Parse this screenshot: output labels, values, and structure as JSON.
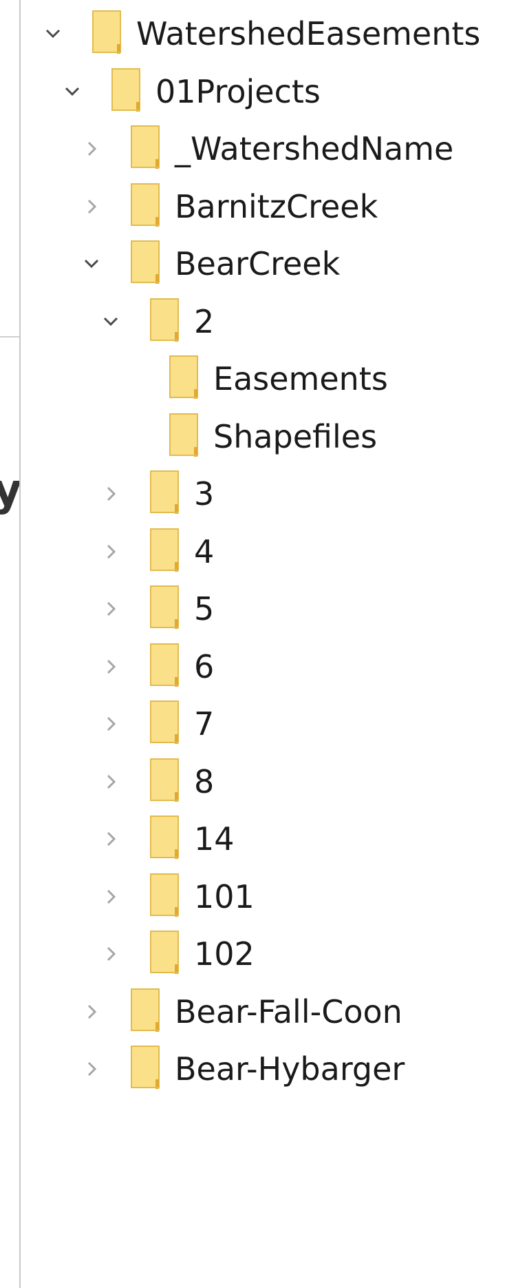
{
  "background": {
    "fragment_text": "ys"
  },
  "tree": {
    "folder_color": "#fbe08a",
    "items": [
      {
        "label": "WatershedEasements",
        "expander": "expanded",
        "depth": 0
      },
      {
        "label": "01Projects",
        "expander": "expanded",
        "depth": 1
      },
      {
        "label": "_WatershedName",
        "expander": "collapsed",
        "depth": 2
      },
      {
        "label": "BarnitzCreek",
        "expander": "collapsed",
        "depth": 2
      },
      {
        "label": "BearCreek",
        "expander": "expanded",
        "depth": 2
      },
      {
        "label": "2",
        "expander": "expanded",
        "depth": 3
      },
      {
        "label": "Easements",
        "expander": "none",
        "depth": 4
      },
      {
        "label": "Shapefiles",
        "expander": "none",
        "depth": 4
      },
      {
        "label": "3",
        "expander": "collapsed",
        "depth": 3
      },
      {
        "label": "4",
        "expander": "collapsed",
        "depth": 3
      },
      {
        "label": "5",
        "expander": "collapsed",
        "depth": 3
      },
      {
        "label": "6",
        "expander": "collapsed",
        "depth": 3
      },
      {
        "label": "7",
        "expander": "collapsed",
        "depth": 3
      },
      {
        "label": "8",
        "expander": "collapsed",
        "depth": 3
      },
      {
        "label": "14",
        "expander": "collapsed",
        "depth": 3
      },
      {
        "label": "101",
        "expander": "collapsed",
        "depth": 3
      },
      {
        "label": "102",
        "expander": "collapsed",
        "depth": 3
      },
      {
        "label": "Bear-Fall-Coon",
        "expander": "collapsed",
        "depth": 2
      },
      {
        "label": "Bear-Hybarger",
        "expander": "collapsed",
        "depth": 2
      }
    ]
  }
}
